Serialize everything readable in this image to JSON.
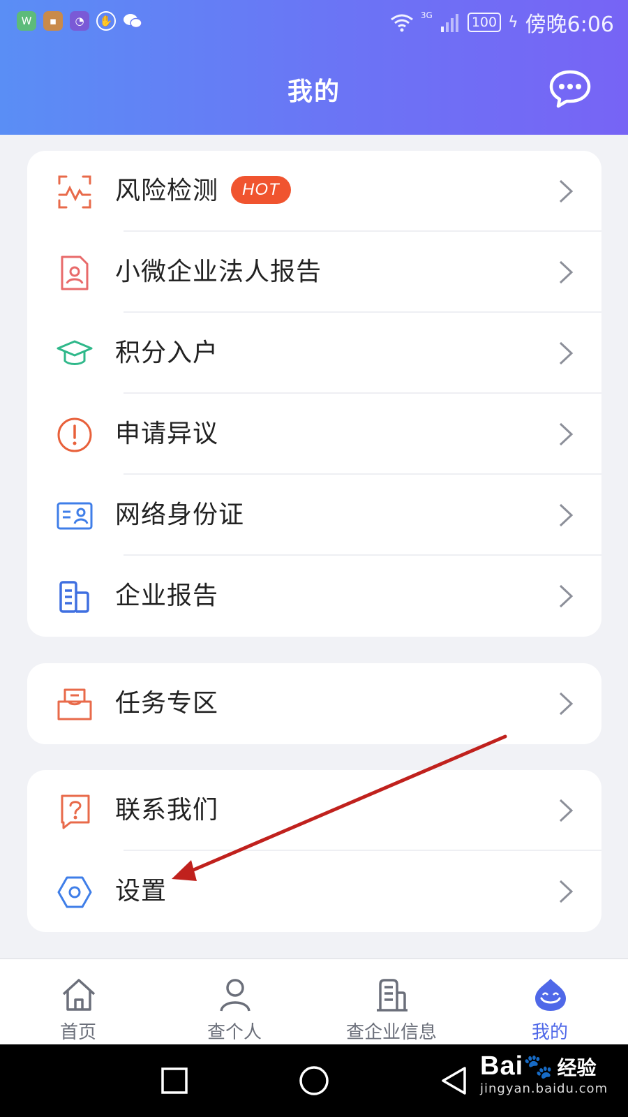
{
  "status_bar": {
    "carrier_time": "傍晚6:06",
    "battery": "100",
    "network": "3G",
    "app_icons": [
      "wallet-app-icon",
      "box-app-icon",
      "pie-app-icon",
      "hand-app-icon",
      "wechat-app-icon"
    ]
  },
  "header": {
    "title": "我的",
    "message_icon": "message-bubble-icon"
  },
  "sections": {
    "primary": {
      "items": [
        {
          "label": "风险检测",
          "badge": "HOT",
          "icon": "pulse-scan-icon"
        },
        {
          "label": "小微企业法人报告",
          "icon": "person-doc-icon"
        },
        {
          "label": "积分入户",
          "icon": "graduation-cap-icon"
        },
        {
          "label": "申请异议",
          "icon": "exclamation-circle-icon"
        },
        {
          "label": "网络身份证",
          "icon": "id-card-icon"
        },
        {
          "label": "企业报告",
          "icon": "building-doc-icon"
        }
      ]
    },
    "tasks": {
      "items": [
        {
          "label": "任务专区",
          "icon": "inbox-tray-icon"
        }
      ]
    },
    "support": {
      "items": [
        {
          "label": "联系我们",
          "icon": "question-bubble-icon"
        },
        {
          "label": "设置",
          "icon": "hexagon-gear-icon"
        }
      ]
    }
  },
  "tabbar": {
    "tabs": [
      {
        "label": "首页",
        "icon": "home-icon",
        "active": false
      },
      {
        "label": "查个人",
        "icon": "person-icon",
        "active": false
      },
      {
        "label": "查企业信息",
        "icon": "building-icon",
        "active": false
      },
      {
        "label": "我的",
        "icon": "mascot-icon",
        "active": true
      }
    ]
  },
  "watermark": {
    "brand": "Bai",
    "brand_tail": "经验",
    "url": "jingyan.baidu.com"
  },
  "colors": {
    "header_start": "#5a8ef5",
    "header_end": "#7764f5",
    "hot_badge": "#f0542f",
    "accent": "#4f68e8",
    "annotation_arrow": "#c0211d"
  }
}
